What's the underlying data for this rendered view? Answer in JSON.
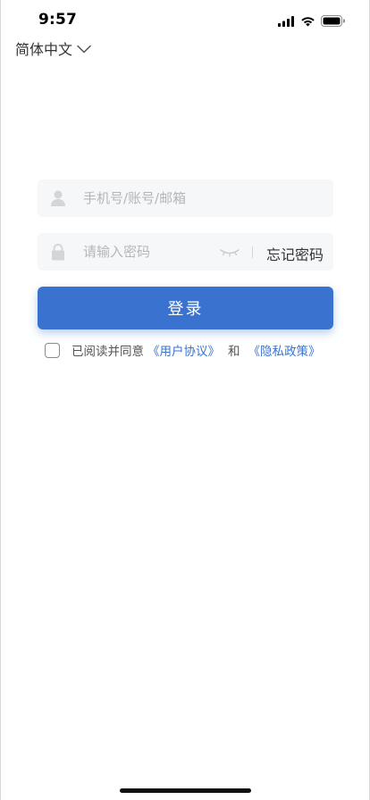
{
  "status_bar": {
    "time": "9:57",
    "icons": [
      "cellular-signal-icon",
      "wifi-icon",
      "battery-icon"
    ]
  },
  "language": {
    "current": "简体中文",
    "icon": "chevron-down-icon"
  },
  "account_field": {
    "placeholder": "手机号/账号/邮箱",
    "value": "",
    "icon": "user-icon"
  },
  "password_field": {
    "placeholder": "请输入密码",
    "value": "",
    "icon": "lock-icon",
    "visibility_icon": "eye-closed-icon",
    "forgot_label": "忘记密码"
  },
  "login_button": {
    "label": "登录"
  },
  "agreement": {
    "checked": false,
    "prefix": "已阅读并同意",
    "user_agreement": "《用户协议》",
    "and": "和",
    "privacy_policy": "《隐私政策》"
  },
  "colors": {
    "accent": "#3a73cf",
    "field_background": "#f6f7f9",
    "placeholder": "#b4b6ba",
    "text": "#333333"
  }
}
